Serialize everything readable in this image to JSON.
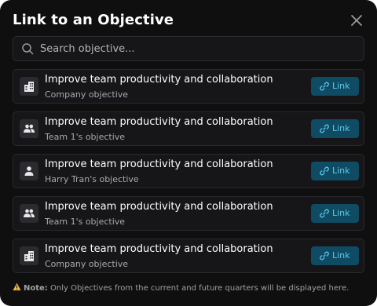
{
  "dialog": {
    "title": "Link to an Objective"
  },
  "search": {
    "placeholder": "Search objective..."
  },
  "objectives": [
    {
      "title": "Improve team productivity and collaboration",
      "owner": "Company objective",
      "icon": "building-icon",
      "link_label": "Link"
    },
    {
      "title": "Improve team productivity and collaboration",
      "owner": "Team 1's objective",
      "icon": "team-icon",
      "link_label": "Link"
    },
    {
      "title": "Improve team productivity and collaboration",
      "owner": "Harry Tran's objective",
      "icon": "user-icon",
      "link_label": "Link"
    },
    {
      "title": "Improve team productivity and collaboration",
      "owner": "Team 1's objective",
      "icon": "team-icon",
      "link_label": "Link"
    },
    {
      "title": "Improve team productivity and collaboration",
      "owner": "Company objective",
      "icon": "building-icon",
      "link_label": "Link"
    }
  ],
  "note": {
    "label": "Note:",
    "text": " Only Objectives from the current and future quarters will be displayed here."
  },
  "colors": {
    "background": "#0f0f10",
    "link_button_bg": "#0f4b63",
    "link_button_text": "#5ec8ef",
    "warning": "#f5b544"
  }
}
